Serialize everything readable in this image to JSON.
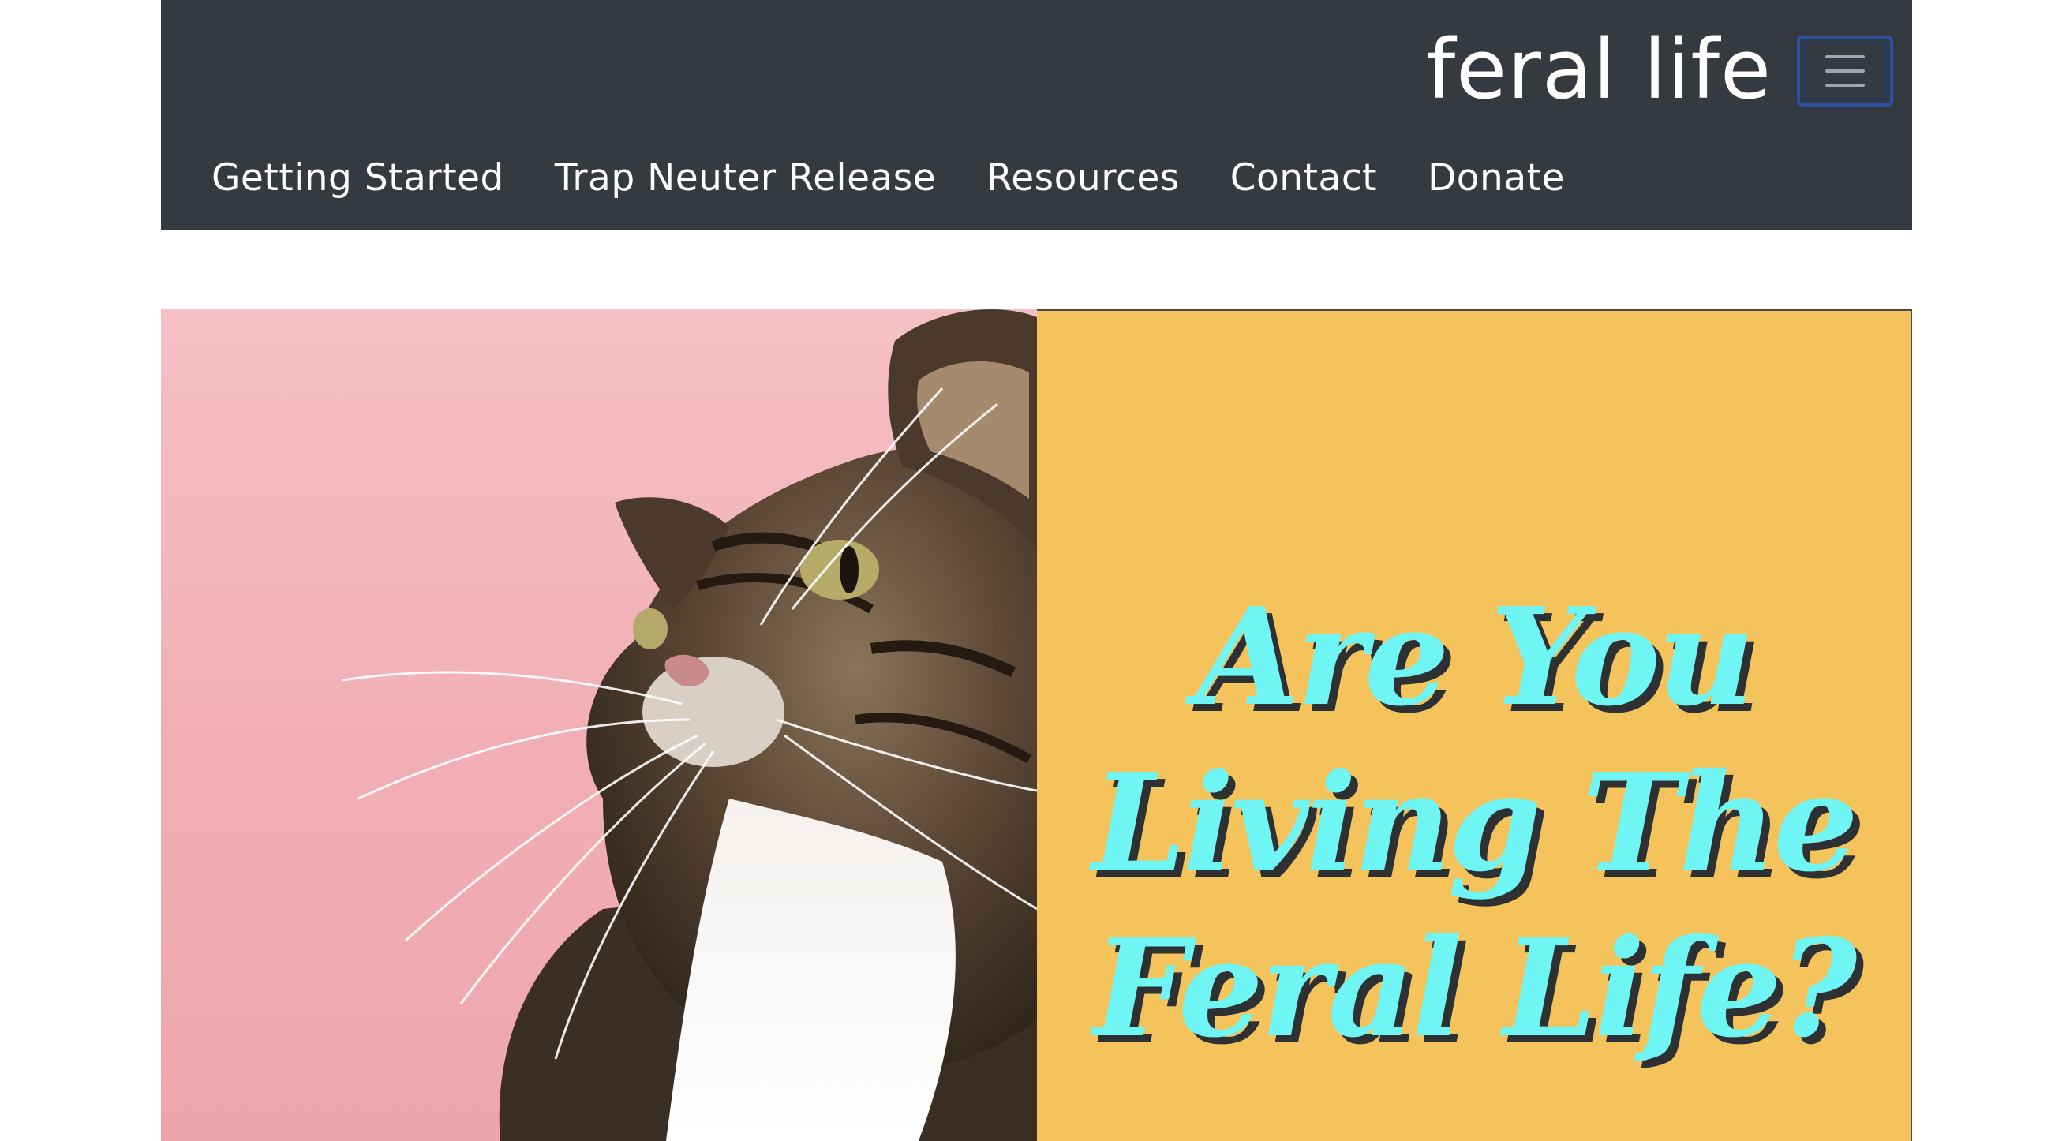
{
  "brand": {
    "name": "feral life"
  },
  "navbar": {
    "toggle_icon": "hamburger-menu-icon",
    "links": [
      {
        "label": "Getting Started"
      },
      {
        "label": "Trap Neuter Release"
      },
      {
        "label": "Resources"
      },
      {
        "label": "Contact"
      },
      {
        "label": "Donate"
      }
    ]
  },
  "hero": {
    "image_subject": "tabby-cat-photo",
    "headline_lines": [
      "Are You",
      "Living The",
      "Feral Life?"
    ]
  },
  "colors": {
    "navbar_bg": "#343a40",
    "toggler_border": "#2952a3",
    "photo_bg": "#f1aeb4",
    "card_bg": "#f4c35c",
    "headline_text": "#6ff6f4",
    "headline_shadow": "#2e3133"
  }
}
